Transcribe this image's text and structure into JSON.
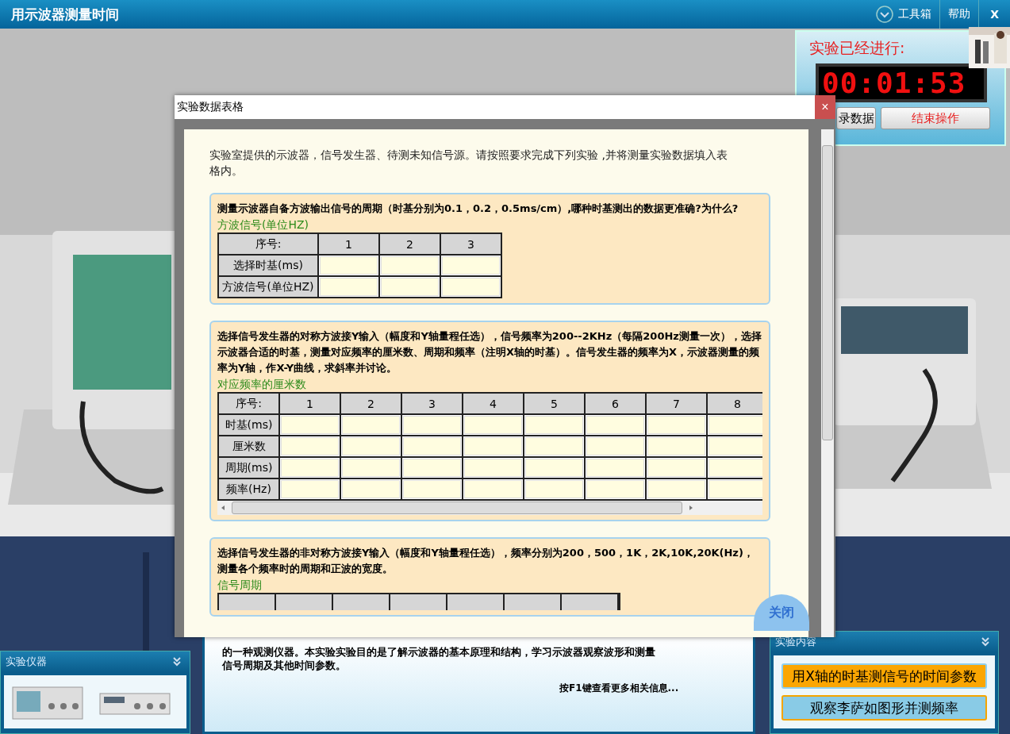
{
  "title_bar": {
    "title": "用示波器测量时间",
    "toolbox": "工具箱",
    "help": "帮助",
    "close": "X"
  },
  "timer_panel": {
    "label": "实验已经进行:",
    "time": "00:01:53",
    "buttons": [
      {
        "label": "录数据",
        "kind": "plain"
      },
      {
        "label": "结束操作",
        "kind": "alert"
      }
    ]
  },
  "dialog": {
    "title": "实验数据表格",
    "close": "×",
    "intro": "实验室提供的示波器，信号发生器、待测未知信号源。请按照要求完成下列实验 ,并将测量实验数据填入表格内。",
    "sections": [
      {
        "question": "测量示波器自备方波输出信号的周期（时基分别为0.1，0.2，0.5ms/cm）,哪种时基测出的数据更准确?为什么?",
        "caption": "方波信号(单位HZ)",
        "kind": "table",
        "header": [
          "序号:",
          "1",
          "2",
          "3"
        ],
        "rows": [
          "选择时基(ms)",
          "方波信号(单位HZ)"
        ]
      },
      {
        "question": "选择信号发生器的对称方波接Y输入（幅度和Y轴量程任选），信号频率为200--2KHz（每隔200Hz测量一次），选择示波器合适的时基，测量对应频率的厘米数、周期和频率（注明X轴的时基）。信号发生器的频率为X，示波器测量的频率为Y轴，作X-Y曲线，求斜率并讨论。",
        "caption": "对应频率的厘米数",
        "kind": "scroll_table",
        "header": [
          "序号:",
          "1",
          "2",
          "3",
          "4",
          "5",
          "6",
          "7",
          "8"
        ],
        "rows": [
          "时基(ms)",
          "厘米数",
          "周期(ms)",
          "频率(Hz)"
        ]
      },
      {
        "question": "选择信号发生器的非对称方波接Y输入（幅度和Y轴量程任选），频率分别为200，500，1K，2K,10K,20K(Hz)，测量各个频率时的周期和正波的宽度。",
        "caption": "信号周期",
        "kind": "cut"
      }
    ],
    "close_button": "关闭"
  },
  "instruments_panel": {
    "title": "实验仪器"
  },
  "info_panel": {
    "lines": [
      "的一种观测仪器。本实验实验目的是了解示波器的基本原理和结构，学习示波器观察波形和测量",
      "信号周期及其他时间参数。"
    ],
    "hint": "按F1键查看更多相关信息..."
  },
  "content_panel": {
    "title": "实验内容",
    "items": [
      {
        "label": "用X轴的时基测信号的时间参数",
        "selected": true
      },
      {
        "label": "观察李萨如图形并测频率",
        "selected": false
      }
    ]
  }
}
